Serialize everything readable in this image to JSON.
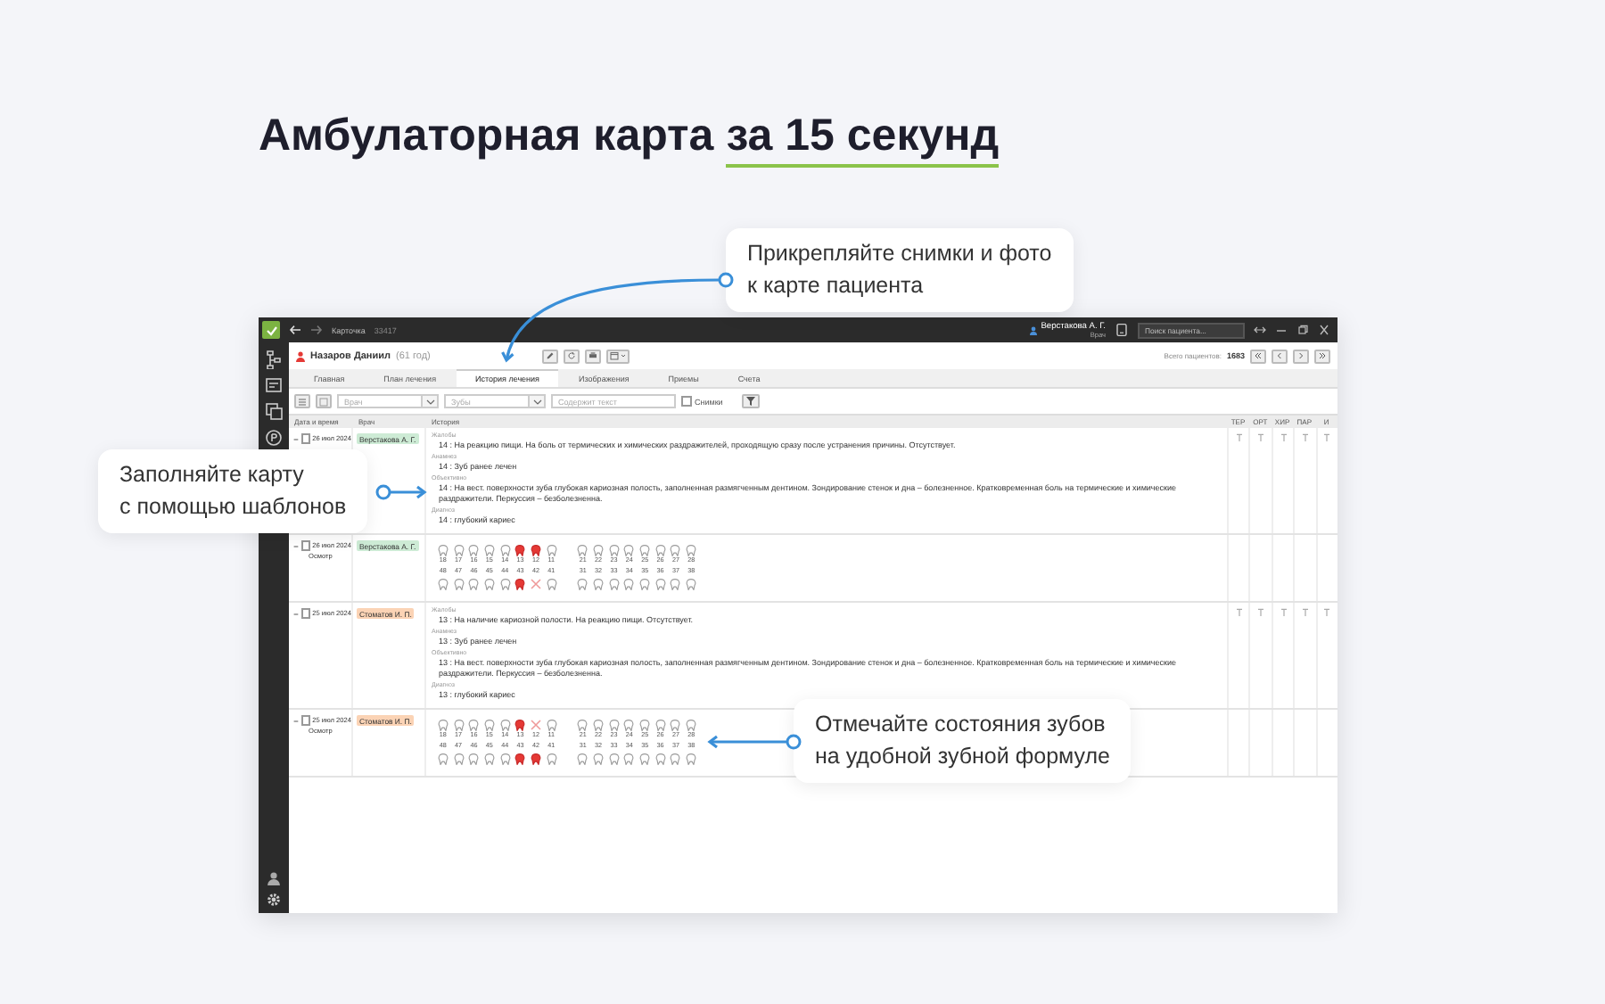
{
  "slide": {
    "title": "Амбулаторная карта",
    "title_highlight": "за 15 секунд"
  },
  "callouts": [
    {
      "text": "Прикрепляйте снимки и фото\nк карте пациента"
    },
    {
      "text": "Заполняйте карту\nс помощью шаблонов"
    },
    {
      "text": "Отмечайте состояния зубов\nна удобной зубной формуле"
    }
  ],
  "app": {
    "titlebar": {
      "section": "Карточка",
      "record_id": "33417",
      "user_name": "Верстакова А. Г.",
      "user_role": "Врач",
      "search_placeholder": "Поиск пациента..."
    },
    "patient": {
      "name": "Назаров Даниил",
      "age": "(61 год)"
    },
    "patients_total_label": "Всего пациентов:",
    "patients_total": "1683",
    "tabs": [
      {
        "label": "Главная",
        "selected": false
      },
      {
        "label": "План лечения",
        "selected": false
      },
      {
        "label": "История лечения",
        "selected": true
      },
      {
        "label": "Изображения",
        "selected": false
      },
      {
        "label": "Приемы",
        "selected": false
      },
      {
        "label": "Счета",
        "selected": false
      }
    ],
    "filters": {
      "doctor_placeholder": "Врач",
      "teeth_placeholder": "Зубы",
      "text_placeholder": "Содержит текст",
      "images_label": "Снимки",
      "images_checked": false
    },
    "table": {
      "columns": [
        "Дата и время",
        "Врач",
        "История",
        "ТЕР",
        "ОРТ",
        "ХИР",
        "ПАР",
        "И"
      ],
      "rows": [
        {
          "kind": "record",
          "expanded": true,
          "checked": false,
          "date": "26 июл 2024",
          "doctor": "Верстакова А. Г.",
          "color": "#cdebd5",
          "sections": [
            {
              "label": "Жалобы",
              "text": "14 : На реакцию пищи. На боль от термических и химических раздражителей, проходящую сразу после устранения причины. Отсутствует."
            },
            {
              "label": "Анамнез",
              "text": "14 : Зуб ранее лечен"
            },
            {
              "label": "Объективно",
              "text": "14 : На вест. поверхности зуба глубокая кариозная полость, заполненная размягченным дентином. Зондирование стенок и дна – болезненное. Кратковременная боль на термические и химические раздражители. Перкуссия – безболезненна."
            },
            {
              "label": "Диагноз",
              "text": "14 : глубокий кариес"
            }
          ]
        },
        {
          "kind": "formula",
          "expanded": true,
          "checked": false,
          "date": "26 июл 2024",
          "subtitle": "Осмотр",
          "doctor": "Верстакова А. Г.",
          "color": "#cdebd5",
          "upper": [
            {
              "number": "18",
              "kind": "healthy"
            },
            {
              "number": "17",
              "kind": "healthy"
            },
            {
              "number": "16",
              "kind": "healthy"
            },
            {
              "number": "15",
              "kind": "healthy"
            },
            {
              "number": "14",
              "kind": "healthy"
            },
            {
              "number": "13",
              "kind": "treated"
            },
            {
              "number": "12",
              "kind": "treated"
            },
            {
              "number": "11",
              "kind": "healthy"
            },
            {
              "number": "21",
              "kind": "healthy"
            },
            {
              "number": "22",
              "kind": "healthy"
            },
            {
              "number": "23",
              "kind": "healthy"
            },
            {
              "number": "24",
              "kind": "healthy"
            },
            {
              "number": "25",
              "kind": "healthy"
            },
            {
              "number": "26",
              "kind": "healthy"
            },
            {
              "number": "27",
              "kind": "healthy"
            },
            {
              "number": "28",
              "kind": "healthy"
            }
          ],
          "lower": [
            {
              "number": "48",
              "kind": "healthy"
            },
            {
              "number": "47",
              "kind": "healthy"
            },
            {
              "number": "46",
              "kind": "healthy"
            },
            {
              "number": "45",
              "kind": "healthy"
            },
            {
              "number": "44",
              "kind": "healthy"
            },
            {
              "number": "43",
              "kind": "treated"
            },
            {
              "number": "42",
              "kind": "missing"
            },
            {
              "number": "41",
              "kind": "healthy"
            },
            {
              "number": "31",
              "kind": "healthy"
            },
            {
              "number": "32",
              "kind": "healthy"
            },
            {
              "number": "33",
              "kind": "healthy"
            },
            {
              "number": "34",
              "kind": "healthy"
            },
            {
              "number": "35",
              "kind": "healthy"
            },
            {
              "number": "36",
              "kind": "healthy"
            },
            {
              "number": "37",
              "kind": "healthy"
            },
            {
              "number": "38",
              "kind": "healthy"
            }
          ]
        },
        {
          "kind": "record",
          "expanded": true,
          "checked": false,
          "date": "25 июл 2024",
          "doctor": "Стоматов И. П.",
          "color": "#fbd3b5",
          "sections": [
            {
              "label": "Жалобы",
              "text": "13 : На наличие кариозной полости. На реакцию пищи. Отсутствует."
            },
            {
              "label": "Анамнез",
              "text": "13 : Зуб ранее лечен"
            },
            {
              "label": "Объективно",
              "text": "13 : На вест. поверхности зуба глубокая кариозная полость, заполненная размягченным дентином. Зондирование стенок и дна – болезненное. Кратковременная боль на термические и химические раздражители. Перкуссия – безболезненна."
            },
            {
              "label": "Диагноз",
              "text": "13 : глубокий кариес"
            }
          ]
        },
        {
          "kind": "formula",
          "expanded": true,
          "checked": false,
          "date": "25 июл 2024",
          "subtitle": "Осмотр",
          "doctor": "Стоматов И. П.",
          "color": "#fbd3b5",
          "upper": [
            {
              "number": "18",
              "kind": "healthy"
            },
            {
              "number": "17",
              "kind": "healthy"
            },
            {
              "number": "16",
              "kind": "healthy"
            },
            {
              "number": "15",
              "kind": "healthy"
            },
            {
              "number": "14",
              "kind": "healthy"
            },
            {
              "number": "13",
              "kind": "treated"
            },
            {
              "number": "12",
              "kind": "missing"
            },
            {
              "number": "11",
              "kind": "healthy"
            },
            {
              "number": "21",
              "kind": "healthy"
            },
            {
              "number": "22",
              "kind": "healthy"
            },
            {
              "number": "23",
              "kind": "healthy"
            },
            {
              "number": "24",
              "kind": "healthy"
            },
            {
              "number": "25",
              "kind": "healthy"
            },
            {
              "number": "26",
              "kind": "healthy"
            },
            {
              "number": "27",
              "kind": "healthy"
            },
            {
              "number": "28",
              "kind": "healthy"
            }
          ],
          "lower": [
            {
              "number": "48",
              "kind": "healthy"
            },
            {
              "number": "47",
              "kind": "healthy"
            },
            {
              "number": "46",
              "kind": "healthy"
            },
            {
              "number": "45",
              "kind": "healthy"
            },
            {
              "number": "44",
              "kind": "healthy"
            },
            {
              "number": "43",
              "kind": "treated"
            },
            {
              "number": "42",
              "kind": "treated"
            },
            {
              "number": "41",
              "kind": "healthy"
            },
            {
              "number": "31",
              "kind": "healthy"
            },
            {
              "number": "32",
              "kind": "healthy"
            },
            {
              "number": "33",
              "kind": "healthy"
            },
            {
              "number": "34",
              "kind": "healthy"
            },
            {
              "number": "35",
              "kind": "healthy"
            },
            {
              "number": "36",
              "kind": "healthy"
            },
            {
              "number": "37",
              "kind": "healthy"
            },
            {
              "number": "38",
              "kind": "healthy"
            }
          ]
        }
      ]
    }
  }
}
